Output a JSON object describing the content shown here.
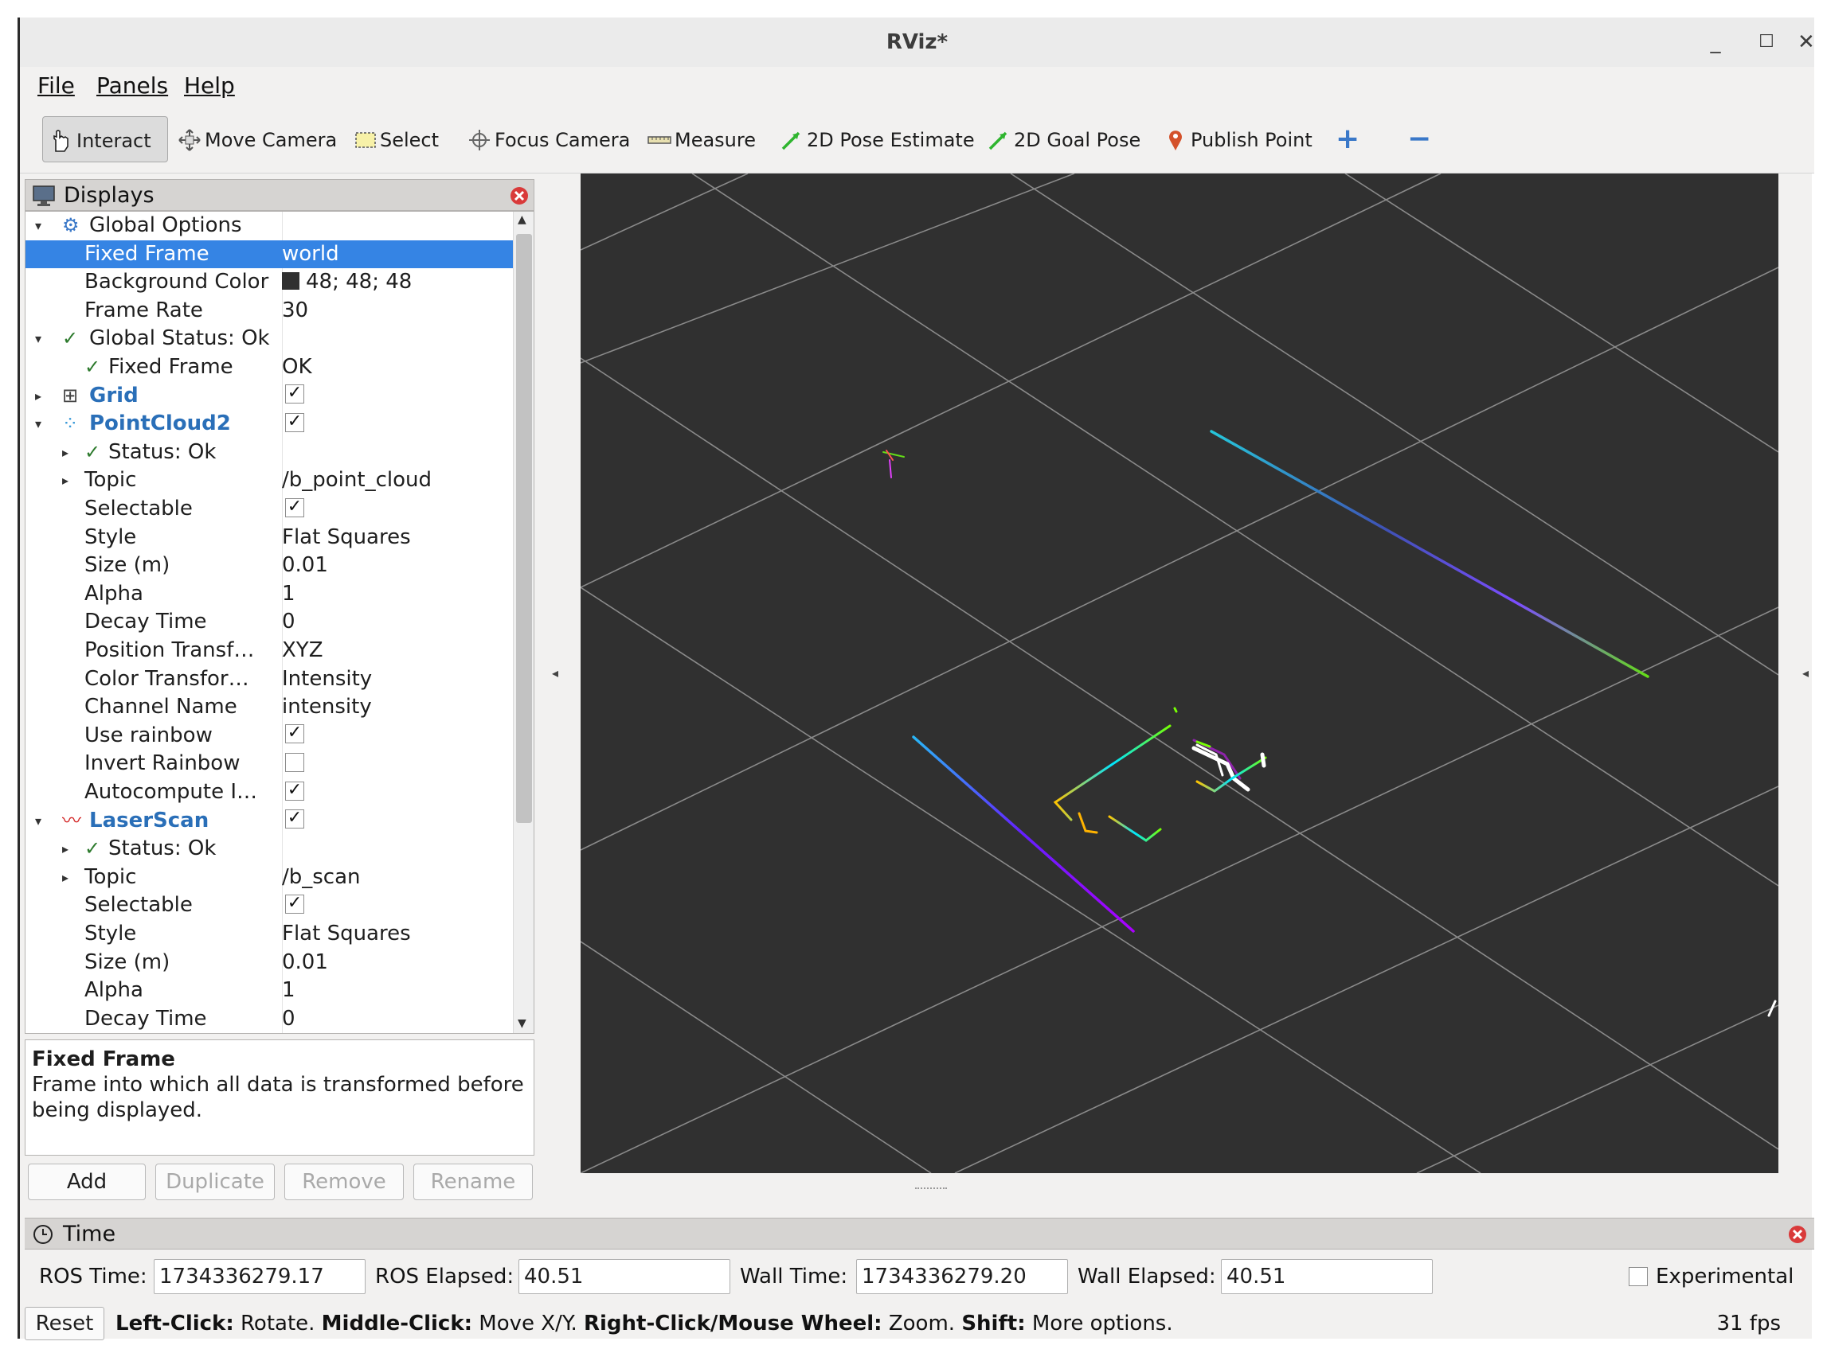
{
  "window": {
    "title": "RViz*",
    "minimize": "_",
    "maximize": "☐",
    "close": "✕"
  },
  "menu": [
    "File",
    "Panels",
    "Help"
  ],
  "toolbar": {
    "interact": "Interact",
    "move_camera": "Move Camera",
    "select": "Select",
    "focus_camera": "Focus Camera",
    "measure": "Measure",
    "pose_estimate": "2D Pose Estimate",
    "goal_pose": "2D Goal Pose",
    "publish_point": "Publish Point",
    "add_tool": "+",
    "remove_tool": "−"
  },
  "displays": {
    "title": "Displays",
    "rows": [
      {
        "indent": 0,
        "arrow": "▾",
        "icon": "gear-icon",
        "name": "Global Options",
        "value": "",
        "kind": "plain"
      },
      {
        "indent": 1,
        "arrow": "",
        "icon": "",
        "name": "Fixed Frame",
        "value": "world",
        "kind": "selected"
      },
      {
        "indent": 1,
        "arrow": "",
        "icon": "",
        "name": "Background Color",
        "value": "48; 48; 48",
        "kind": "color"
      },
      {
        "indent": 1,
        "arrow": "",
        "icon": "",
        "name": "Frame Rate",
        "value": "30",
        "kind": "plain"
      },
      {
        "indent": 0,
        "arrow": "▾",
        "icon": "check-icon",
        "name": "Global Status: Ok",
        "value": "",
        "kind": "plain"
      },
      {
        "indent": 1,
        "arrow": "",
        "icon": "check-icon",
        "name": "Fixed Frame",
        "value": "OK",
        "kind": "plain"
      },
      {
        "indent": 0,
        "arrow": "▸",
        "icon": "grid-icon",
        "name": "Grid",
        "value": "✓",
        "kind": "plugin"
      },
      {
        "indent": 0,
        "arrow": "▾",
        "icon": "pointcloud-icon",
        "name": "PointCloud2",
        "value": "✓",
        "kind": "plugin"
      },
      {
        "indent": 1,
        "arrow": "▸",
        "icon": "check-icon",
        "name": "Status: Ok",
        "value": "",
        "kind": "plain"
      },
      {
        "indent": 1,
        "arrow": "▸",
        "icon": "",
        "name": "Topic",
        "value": "/b_point_cloud",
        "kind": "plain"
      },
      {
        "indent": 1,
        "arrow": "",
        "icon": "",
        "name": "Selectable",
        "value": "✓",
        "kind": "checkbox"
      },
      {
        "indent": 1,
        "arrow": "",
        "icon": "",
        "name": "Style",
        "value": "Flat Squares",
        "kind": "plain"
      },
      {
        "indent": 1,
        "arrow": "",
        "icon": "",
        "name": "Size (m)",
        "value": "0.01",
        "kind": "plain"
      },
      {
        "indent": 1,
        "arrow": "",
        "icon": "",
        "name": "Alpha",
        "value": "1",
        "kind": "plain"
      },
      {
        "indent": 1,
        "arrow": "",
        "icon": "",
        "name": "Decay Time",
        "value": "0",
        "kind": "plain"
      },
      {
        "indent": 1,
        "arrow": "",
        "icon": "",
        "name": "Position Transf…",
        "value": "XYZ",
        "kind": "plain"
      },
      {
        "indent": 1,
        "arrow": "",
        "icon": "",
        "name": "Color Transfor…",
        "value": "Intensity",
        "kind": "plain"
      },
      {
        "indent": 1,
        "arrow": "",
        "icon": "",
        "name": "Channel Name",
        "value": "intensity",
        "kind": "plain"
      },
      {
        "indent": 1,
        "arrow": "",
        "icon": "",
        "name": "Use rainbow",
        "value": "✓",
        "kind": "checkbox"
      },
      {
        "indent": 1,
        "arrow": "",
        "icon": "",
        "name": "Invert Rainbow",
        "value": "",
        "kind": "checkbox"
      },
      {
        "indent": 1,
        "arrow": "",
        "icon": "",
        "name": "Autocompute I…",
        "value": "✓",
        "kind": "checkbox"
      },
      {
        "indent": 0,
        "arrow": "▾",
        "icon": "laserscan-icon",
        "name": "LaserScan",
        "value": "✓",
        "kind": "plugin"
      },
      {
        "indent": 1,
        "arrow": "▸",
        "icon": "check-icon",
        "name": "Status: Ok",
        "value": "",
        "kind": "plain"
      },
      {
        "indent": 1,
        "arrow": "▸",
        "icon": "",
        "name": "Topic",
        "value": "/b_scan",
        "kind": "plain"
      },
      {
        "indent": 1,
        "arrow": "",
        "icon": "",
        "name": "Selectable",
        "value": "✓",
        "kind": "checkbox"
      },
      {
        "indent": 1,
        "arrow": "",
        "icon": "",
        "name": "Style",
        "value": "Flat Squares",
        "kind": "plain"
      },
      {
        "indent": 1,
        "arrow": "",
        "icon": "",
        "name": "Size (m)",
        "value": "0.01",
        "kind": "plain"
      },
      {
        "indent": 1,
        "arrow": "",
        "icon": "",
        "name": "Alpha",
        "value": "1",
        "kind": "plain"
      },
      {
        "indent": 1,
        "arrow": "",
        "icon": "",
        "name": "Decay Time",
        "value": "0",
        "kind": "plain"
      }
    ],
    "description_title": "Fixed Frame",
    "description_text": "Frame into which all data is transformed before being displayed.",
    "buttons": {
      "add": "Add",
      "duplicate": "Duplicate",
      "remove": "Remove",
      "rename": "Rename"
    }
  },
  "viewport": {
    "background_color": "#303030"
  },
  "time": {
    "title": "Time",
    "ros_time_label": "ROS Time:",
    "ros_time": "1734336279.17",
    "ros_elapsed_label": "ROS Elapsed:",
    "ros_elapsed": "40.51",
    "wall_time_label": "Wall Time:",
    "wall_time": "1734336279.20",
    "wall_elapsed_label": "Wall Elapsed:",
    "wall_elapsed": "40.51",
    "experimental": "Experimental"
  },
  "status": {
    "reset": "Reset",
    "hint_parts": [
      {
        "b": "Left-Click:",
        "t": " Rotate. "
      },
      {
        "b": "Middle-Click:",
        "t": " Move X/Y. "
      },
      {
        "b": "Right-Click/Mouse Wheel:",
        "t": " Zoom. "
      },
      {
        "b": "Shift:",
        "t": " More options."
      }
    ],
    "fps": "31 fps"
  },
  "colors": {
    "selection": "#3584e4",
    "plugin_text": "#2a6fb8",
    "status_ok": "#2d7a2d"
  }
}
